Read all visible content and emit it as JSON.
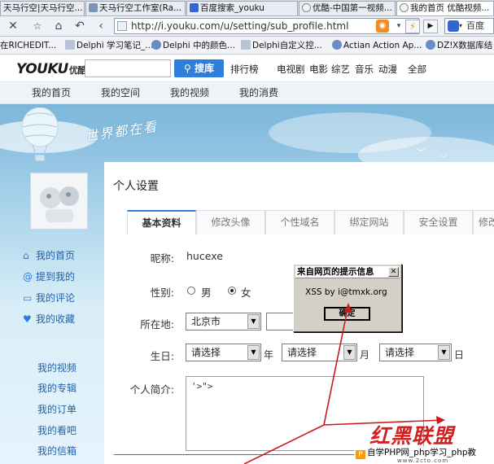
{
  "browser": {
    "tabs": [
      {
        "label": "天马行空|天马行空..."
      },
      {
        "label": "天马行空工作室(Ra..."
      },
      {
        "label": "百度搜索_youku"
      },
      {
        "label": "优酷-中国第一视频..."
      },
      {
        "label": "我的首页 优酷视频..."
      }
    ],
    "url": "http://i.youku.com/u/setting/sub_profile.html",
    "search_text": "百度",
    "bookmarks": [
      {
        "label": "在RICHEDIT..."
      },
      {
        "label": "Delphi 学习笔记_..."
      },
      {
        "label": "Delphi 中的颜色..."
      },
      {
        "label": "Delphi自定义控..."
      },
      {
        "label": "Actian Action Ap..."
      },
      {
        "label": "DZ!"
      },
      {
        "label": "X数据库结"
      }
    ]
  },
  "youku": {
    "logo_text": "YOUKU",
    "logo_cn": "优酷",
    "search_button": "搜库",
    "channels": [
      "排行榜",
      "电视剧",
      "电影",
      "综艺",
      "音乐",
      "动漫",
      "全部"
    ],
    "subnav": [
      "我的首页",
      "我的空间",
      "我的视频",
      "我的消费"
    ],
    "slogan": "世界都在看"
  },
  "sidebar": {
    "group1": [
      {
        "label": "我的首页",
        "icon": "home-icon"
      },
      {
        "label": "提到我的",
        "icon": "at-icon"
      },
      {
        "label": "我的评论",
        "icon": "comment-icon"
      },
      {
        "label": "我的收藏",
        "icon": "heart-icon"
      }
    ],
    "group2": [
      "我的视频",
      "我的专辑",
      "我的订单",
      "我的看吧",
      "我的信箱"
    ]
  },
  "settings": {
    "title": "个人设置",
    "tabs": [
      "基本资料",
      "修改头像",
      "个性域名",
      "绑定网站",
      "安全设置",
      "修改"
    ],
    "active_tab": "基本资料",
    "nickname_label": "昵称:",
    "nickname_value": "hucexe",
    "gender_label": "性别:",
    "gender_male": "男",
    "gender_female": "女",
    "gender_selected": "女",
    "location_label": "所在地:",
    "location_value": "北京市",
    "birthday_label": "生日:",
    "birthday_year": "请选择",
    "birthday_month": "请选择",
    "birthday_day": "请选择",
    "year_unit": "年",
    "month_unit": "月",
    "day_unit": "日",
    "bio_label": "个人简介:",
    "bio_value": "'>\">"
  },
  "alert": {
    "title": "来自网页的提示信息",
    "message": "XSS by i@tmxk.org",
    "ok_label": "确定"
  },
  "watermark": {
    "brand": "红黑联盟",
    "bar_text": "自学PHP网_php学习_php教",
    "url": "www.2cto.com"
  }
}
